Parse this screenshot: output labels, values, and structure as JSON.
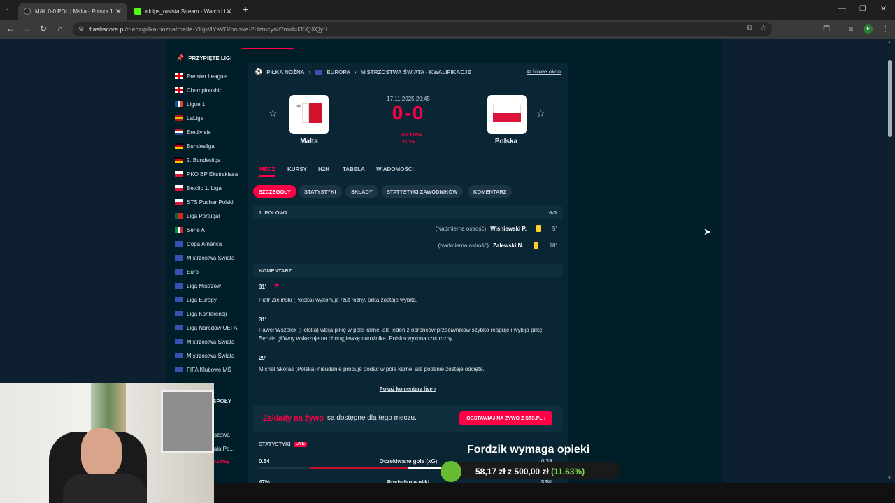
{
  "browser": {
    "tabs": [
      {
        "label": "MAL 0-0 POL | Malta - Polska 1"
      },
      {
        "label": "eklips_rasista Stream - Watch Li"
      }
    ],
    "url_main": "flashscore.pl",
    "url_rest": "/mecz/pilka-nozna/malta-YHpMYsVG/polska-2Hzmcynl/?mid=I35QXQyR",
    "profile_initial": "F"
  },
  "sidebar": {
    "title": "PRZYPIĘTE LIGI",
    "leagues": [
      {
        "label": "Premier League",
        "flag": "eng"
      },
      {
        "label": "Championship",
        "flag": "eng"
      },
      {
        "label": "Ligue 1",
        "flag": "fr"
      },
      {
        "label": "LaLiga",
        "flag": "es"
      },
      {
        "label": "Eredivisie",
        "flag": "nl"
      },
      {
        "label": "Bundesliga",
        "flag": "de"
      },
      {
        "label": "2. Bundesliga",
        "flag": "de"
      },
      {
        "label": "PKO BP Ekstraklasa",
        "flag": "pl"
      },
      {
        "label": "Betclic 1. Liga",
        "flag": "pl"
      },
      {
        "label": "STS Puchar Polski",
        "flag": "pl"
      },
      {
        "label": "Liga Portugal",
        "flag": "pt"
      },
      {
        "label": "Serie A",
        "flag": "it"
      },
      {
        "label": "Copa America",
        "flag": "world"
      },
      {
        "label": "Mistrzostwa Świata",
        "flag": "world"
      },
      {
        "label": "Euro",
        "flag": "world"
      },
      {
        "label": "Liga Mistrzów",
        "flag": "world"
      },
      {
        "label": "Liga Europy",
        "flag": "world"
      },
      {
        "label": "Liga Konferencji",
        "flag": "world"
      },
      {
        "label": "Liga Narodów UEFA",
        "flag": "world"
      },
      {
        "label": "Mistrzostwa Świata",
        "flag": "world"
      },
      {
        "label": "Mistrzostwa Świata",
        "flag": "world"
      },
      {
        "label": "FIFA Klubowe MŚ",
        "flag": "world"
      }
    ],
    "partial_labels": [
      "SPOŁY",
      "szawa",
      "iała Po...",
      "UZYNĘ"
    ]
  },
  "match": {
    "breadcrumb": [
      "PIŁKA NOŻNA",
      "EUROPA",
      "MISTRZOSTWA ŚWIATA - KWALIFIKACJE"
    ],
    "new_window": "Nowe okno",
    "home": "Malta",
    "away": "Polska",
    "datetime": "17.11.2025 20:45",
    "score": "0-0",
    "status_line1": "1. POŁOWA",
    "status_line2": "31:16",
    "tabs": [
      "MECZ",
      "KURSY",
      "H2H",
      "TABELA",
      "WIADOMOŚCI"
    ],
    "subtabs": [
      "SZCZEGÓŁY",
      "STATYSTYKI",
      "SKŁADY",
      "STATYSTYKI ZAWODNIKÓW",
      "KOMENTARZ"
    ],
    "half_label": "1. POŁOWA",
    "half_score": "0-0",
    "events": [
      {
        "note": "(Nadmierna ostrość)",
        "player": "Wiśniewski P.",
        "minute": "5'"
      },
      {
        "note": "(Nadmierna ostrość)",
        "player": "Zalewski N.",
        "minute": "18'"
      }
    ],
    "commentary_label": "KOMENTARZ",
    "commentary": [
      {
        "minute": "31'",
        "text": "Piotr Zieliński (Polska) wykonuje rzut rożny, piłka zostaje wybita."
      },
      {
        "minute": "31'",
        "text": "Paweł Wszołek (Polska) wbija piłkę w pole karne, ale jeden z obrońców przeciwników szybko reaguje i wybija piłkę. Sędzia główny wskazuje na chorągiewkę narożnika, Polska wykona rzut rożny."
      },
      {
        "minute": "29'",
        "text": "Michał Skóraś (Polska) nieudanie próbuje podać w pole karne, ale podanie zostaje odcięte."
      }
    ],
    "show_more": "Pokaż komentarz live",
    "bet_title": "Zakłady na żywo",
    "bet_text": "są dostępne dla tego meczu.",
    "bet_button": "OBSTAWIAJ NA ŻYWO Z STS.PL",
    "stats_label": "STATYSTYKI",
    "live_badge": "LIVE",
    "stats": [
      {
        "home": "0.54",
        "label": "Oczekiwane gole (xG)",
        "away": "0.28",
        "home_share": 0.66
      },
      {
        "home": "47%",
        "label": "Posiadanie piłki",
        "away": "53%"
      }
    ]
  },
  "overlay": {
    "donation_title": "Fordzik wymaga opieki",
    "donation_amount": "58,17 zł",
    "donation_of": "z",
    "donation_goal": "500,00 zł",
    "donation_pct": "(11.63%)"
  }
}
